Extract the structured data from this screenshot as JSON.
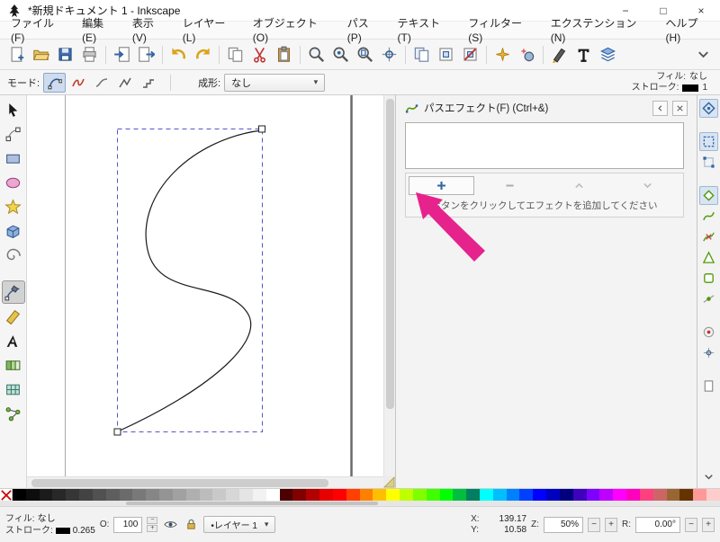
{
  "window": {
    "title": "*新規ドキュメント 1 - Inkscape",
    "controls": {
      "minimize": "−",
      "maximize": "□",
      "close": "×"
    }
  },
  "glyphs": {
    "dropdown": "▾",
    "spin_minus": "−",
    "spin_plus": "+"
  },
  "menubar": {
    "items": [
      "ファイル(F)",
      "編集(E)",
      "表示(V)",
      "レイヤー(L)",
      "オブジェクト(O)",
      "パス(P)",
      "テキスト(T)",
      "フィルター(S)",
      "エクステンション(N)",
      "ヘルプ(H)"
    ]
  },
  "toolbar": {
    "buttons": [
      {
        "name": "new-document-button",
        "kind": "doc-new"
      },
      {
        "name": "open-document-button",
        "kind": "folder-open"
      },
      {
        "name": "save-button",
        "kind": "save"
      },
      {
        "name": "print-button",
        "kind": "print"
      },
      {
        "sep": true
      },
      {
        "name": "import-button",
        "kind": "import"
      },
      {
        "name": "export-button",
        "kind": "export"
      },
      {
        "sep": true
      },
      {
        "name": "undo-button",
        "kind": "undo"
      },
      {
        "name": "redo-button",
        "kind": "redo"
      },
      {
        "sep": true
      },
      {
        "name": "copy-button",
        "kind": "copy"
      },
      {
        "name": "cut-button",
        "kind": "cut"
      },
      {
        "name": "paste-button",
        "kind": "paste"
      },
      {
        "sep": true
      },
      {
        "name": "zoom-selection-button",
        "kind": "zoom"
      },
      {
        "name": "zoom-drawing-button",
        "kind": "zoom-drawing"
      },
      {
        "name": "zoom-page-button",
        "kind": "zoom-page"
      },
      {
        "name": "view-center-page-button",
        "kind": "grid-center"
      },
      {
        "sep": true
      },
      {
        "name": "duplicate-button",
        "kind": "duplicate"
      },
      {
        "name": "create-clone-button",
        "kind": "clone"
      },
      {
        "name": "unlink-clone-button",
        "kind": "unlink-clone"
      },
      {
        "sep": true
      },
      {
        "name": "symbols-dialog-button",
        "kind": "sparkle"
      },
      {
        "name": "preferences-button",
        "kind": "sparkle2"
      },
      {
        "sep": true
      },
      {
        "name": "fill-stroke-dialog-button",
        "kind": "pen-dark"
      },
      {
        "name": "text-font-dialog-button",
        "kind": "text-T"
      },
      {
        "name": "layers-dialog-button",
        "kind": "layers"
      },
      {
        "name": "toolbar-overflow-button",
        "kind": "chevron-down",
        "end": true
      }
    ]
  },
  "tool_controls": {
    "mode_label": "モード:",
    "modes": [
      {
        "name": "mode-bezier-button",
        "kind": "mode-bezier",
        "active": true
      },
      {
        "name": "mode-spiro-button",
        "kind": "mode-spiro"
      },
      {
        "name": "mode-bspline-button",
        "kind": "mode-bspline"
      },
      {
        "name": "mode-straight-button",
        "kind": "mode-straight"
      },
      {
        "name": "mode-paraxial-button",
        "kind": "mode-paraxial"
      }
    ],
    "shape_label": "成形:",
    "shape_value": "なし",
    "fill_label": "フィル:",
    "fill_value": "なし",
    "stroke_label": "ストローク:",
    "stroke_width": "1",
    "stroke_color": "#000000"
  },
  "toolbox": {
    "tools": [
      {
        "name": "tool-selector",
        "kind": "select-arrow"
      },
      {
        "name": "tool-node-editor",
        "kind": "node-editor"
      },
      {
        "name": "tool-rectangle",
        "kind": "rect-tool"
      },
      {
        "name": "tool-ellipse",
        "kind": "ellipse-tool"
      },
      {
        "name": "tool-star",
        "kind": "star-tool"
      },
      {
        "name": "tool-3dbox",
        "kind": "box3d-tool"
      },
      {
        "name": "tool-spiral",
        "kind": "spiral-tool"
      },
      {
        "name": "tool-pen-bezier",
        "kind": "pen-tool",
        "active": true,
        "gap": true
      },
      {
        "name": "tool-calligraphy",
        "kind": "calligraphy-tool"
      },
      {
        "name": "tool-text",
        "kind": "text-tool"
      },
      {
        "name": "tool-gradient",
        "kind": "gradient-tool"
      },
      {
        "name": "tool-mesh-gradient",
        "kind": "mesh-tool"
      },
      {
        "name": "tool-connector",
        "kind": "connector-tool"
      }
    ]
  },
  "dock": {
    "title": "パスエフェクト(F) (Ctrl+&)",
    "hint": "ボタンをクリックしてエフェクトを追加してください",
    "buttons": [
      {
        "name": "add-effect-button",
        "kind": "plus-blue",
        "active": true
      },
      {
        "name": "remove-effect-button",
        "kind": "minus-gray"
      },
      {
        "name": "move-effect-up-button",
        "kind": "chevup-gray"
      },
      {
        "name": "move-effect-down-button",
        "kind": "chevdn-gray"
      }
    ]
  },
  "snapbar": {
    "buttons": [
      {
        "name": "snap-enable-button",
        "kind": "snap-master",
        "active": true
      },
      {
        "name": "snap-bbox-button",
        "kind": "snap-bbox",
        "active": true,
        "gap": true
      },
      {
        "name": "snap-bbox-corners-button",
        "kind": "snap-bbox-corner"
      },
      {
        "name": "snap-nodes-button",
        "kind": "snap-node",
        "active": true,
        "gap": true
      },
      {
        "name": "snap-path-button",
        "kind": "snap-path"
      },
      {
        "name": "snap-path-intersections-button",
        "kind": "snap-intersection"
      },
      {
        "name": "snap-cusp-nodes-button",
        "kind": "snap-cusp"
      },
      {
        "name": "snap-smooth-nodes-button",
        "kind": "snap-smooth"
      },
      {
        "name": "snap-midpoints-button",
        "kind": "snap-midpoint"
      },
      {
        "name": "snap-others-button",
        "kind": "snap-others",
        "gap": true
      },
      {
        "name": "snap-rotation-center-button",
        "kind": "snap-rotation"
      },
      {
        "name": "snap-page-border-button",
        "kind": "snap-page",
        "gap": true
      },
      {
        "name": "snapbar-more-button",
        "kind": "chevron-down",
        "end": true
      }
    ]
  },
  "palette": {
    "colors": [
      "#000000",
      "#0d0d0d",
      "#1b1b1b",
      "#282828",
      "#363636",
      "#434343",
      "#515151",
      "#5e5e5e",
      "#6b6b6b",
      "#797979",
      "#868686",
      "#949494",
      "#a1a1a1",
      "#afafaf",
      "#bcbcbc",
      "#c9c9c9",
      "#d7d7d7",
      "#e4e4e4",
      "#f2f2f2",
      "#ffffff",
      "#4d0000",
      "#800000",
      "#b30000",
      "#e60000",
      "#ff0000",
      "#ff4000",
      "#ff8000",
      "#ffbf00",
      "#ffff00",
      "#bfff00",
      "#80ff00",
      "#40ff00",
      "#00ff00",
      "#00bf40",
      "#008060",
      "#00ffff",
      "#00bfff",
      "#0080ff",
      "#0040ff",
      "#0000ff",
      "#0000bf",
      "#000080",
      "#4000bf",
      "#8000ff",
      "#bf00ff",
      "#ff00ff",
      "#ff00bf",
      "#ff4080",
      "#cc6666",
      "#996633",
      "#663300",
      "#ff9999",
      "#ffcccc"
    ]
  },
  "statusbar": {
    "fill_label": "フィル:",
    "fill_value": "なし",
    "stroke_label": "ストローク:",
    "stroke_value": "0.265",
    "stroke_color": "#000000",
    "opacity_label": "O:",
    "opacity_value": "100",
    "layer_label": "•レイヤー 1",
    "x_label": "X:",
    "x_value": "139.17",
    "y_label": "Y:",
    "y_value": "10.58",
    "zoom_label": "Z:",
    "zoom_value": "50%",
    "rotation_label": "R:",
    "rotation_value": "0.00°"
  },
  "colors": {
    "accent_blue": "#3465a4",
    "annotation_pink": "#e6228d",
    "selection_dash": "#5555cc"
  }
}
